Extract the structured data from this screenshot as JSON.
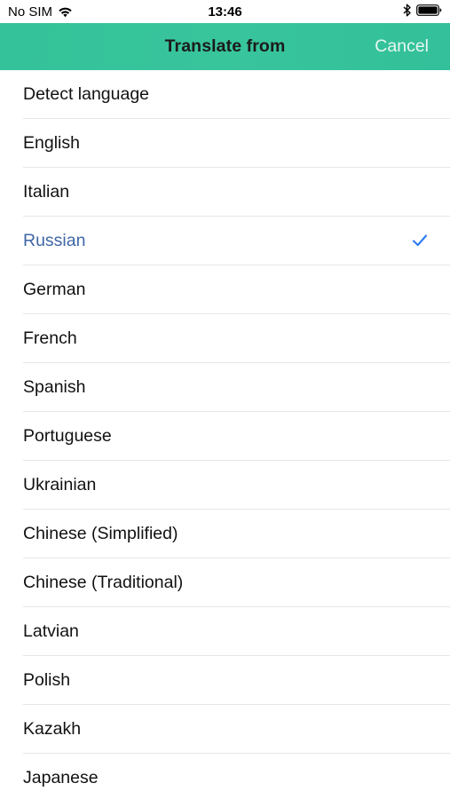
{
  "status_bar": {
    "carrier": "No SIM",
    "time": "13:46"
  },
  "nav": {
    "title": "Translate from",
    "cancel_label": "Cancel"
  },
  "colors": {
    "header_accent": "#36c39b",
    "selected_text": "#3f66a6",
    "checkmark": "#2f7cf6"
  },
  "languages": [
    {
      "label": "Detect language",
      "selected": false
    },
    {
      "label": "English",
      "selected": false
    },
    {
      "label": "Italian",
      "selected": false
    },
    {
      "label": "Russian",
      "selected": true
    },
    {
      "label": "German",
      "selected": false
    },
    {
      "label": "French",
      "selected": false
    },
    {
      "label": "Spanish",
      "selected": false
    },
    {
      "label": "Portuguese",
      "selected": false
    },
    {
      "label": "Ukrainian",
      "selected": false
    },
    {
      "label": "Chinese (Simplified)",
      "selected": false
    },
    {
      "label": "Chinese (Traditional)",
      "selected": false
    },
    {
      "label": "Latvian",
      "selected": false
    },
    {
      "label": "Polish",
      "selected": false
    },
    {
      "label": "Kazakh",
      "selected": false
    },
    {
      "label": "Japanese",
      "selected": false
    }
  ],
  "icons": {
    "wifi": "wifi-icon",
    "bluetooth": "bluetooth-icon",
    "battery": "battery-icon",
    "selected_marker": "checkmark-icon"
  }
}
